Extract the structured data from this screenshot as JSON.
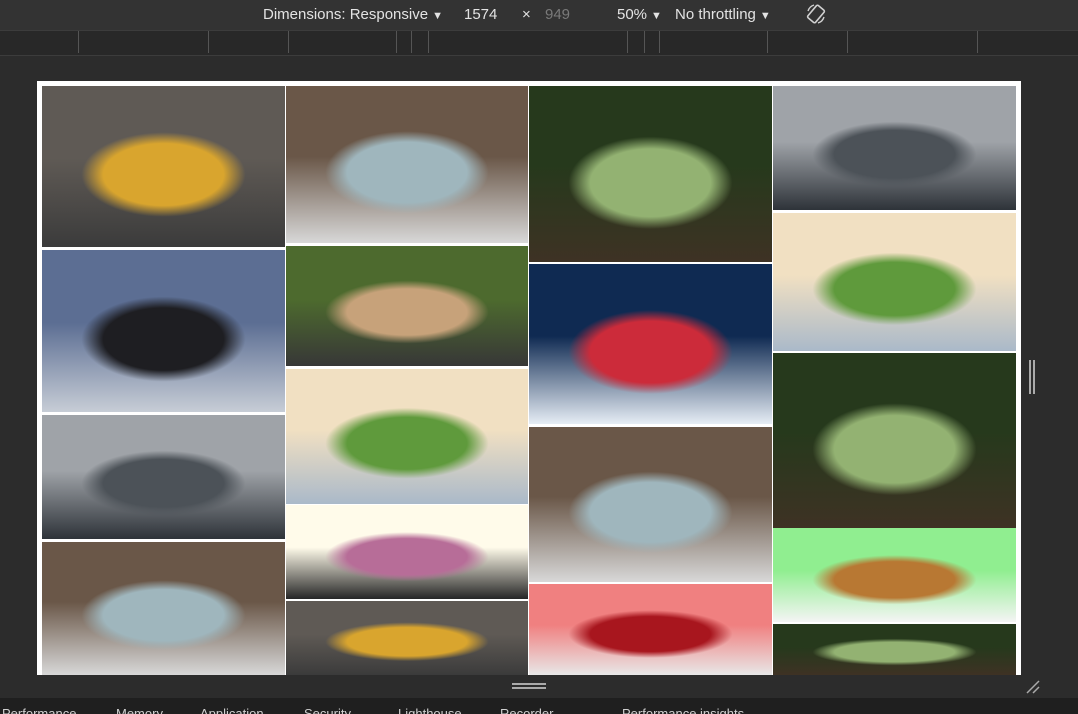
{
  "toolbar": {
    "dimensions_label": "Dimensions: Responsive",
    "width": "1574",
    "times": "×",
    "height": "949",
    "zoom": "50%",
    "throttling": "No throttling"
  },
  "viewport": {
    "tiles": [
      {
        "name": "yellow-sedan-photo",
        "colors": [
          "#5f5a55",
          "#d9a52e",
          "#3b3b3b"
        ]
      },
      {
        "name": "silver-convertible-photo",
        "colors": [
          "#6a5748",
          "#9fb6bd",
          "#d8d8d8"
        ]
      },
      {
        "name": "green-microcar-photo",
        "colors": [
          "#26391c",
          "#93b272",
          "#3e3224"
        ]
      },
      {
        "name": "grey-coupe-garage-photo",
        "colors": [
          "#9fa3a8",
          "#4c5258",
          "#2e3339"
        ]
      },
      {
        "name": "black-mustang-photo",
        "colors": [
          "#5c6e93",
          "#1e1e22",
          "#c7cdd6"
        ]
      },
      {
        "name": "convertible-interior-photo",
        "colors": [
          "#4d6a2e",
          "#c7a27a",
          "#373737"
        ]
      },
      {
        "name": "red-beetle-snow-photo",
        "colors": [
          "#0f2a52",
          "#cc2b3a",
          "#e6edf5"
        ]
      },
      {
        "name": "palm-beach-aerial-photo",
        "colors": [
          "#f1e0c2",
          "#5f9a3c",
          "#aab9c9"
        ]
      },
      {
        "name": "palm-beach-aerial-photo-2",
        "colors": [
          "#f1e0c2",
          "#5f9a3c",
          "#aab9c9"
        ]
      },
      {
        "name": "grey-coupe-garage-photo-2",
        "colors": [
          "#9fa3a8",
          "#4c5258",
          "#2e3339"
        ]
      },
      {
        "name": "silver-convertible-photo-2",
        "colors": [
          "#6a5748",
          "#9fb6bd",
          "#d8d8d8"
        ]
      },
      {
        "name": "green-microcar-photo-2",
        "colors": [
          "#26391c",
          "#93b272",
          "#3e3224"
        ]
      },
      {
        "name": "pink-sedan-photo",
        "colors": [
          "#fffbea",
          "#b76d98",
          "#262626"
        ]
      },
      {
        "name": "silver-convertible-photo-3",
        "colors": [
          "#6a5748",
          "#9fb6bd",
          "#d8d8d8"
        ]
      },
      {
        "name": "brown-convertible-photo",
        "colors": [
          "#90ee90",
          "#b87833",
          "#f5f5f5"
        ]
      },
      {
        "name": "yellow-sedan-photo-2",
        "colors": [
          "#5f5a55",
          "#d9a52e",
          "#3b3b3b"
        ]
      },
      {
        "name": "red-convertible-photo",
        "colors": [
          "#f08080",
          "#a8161e",
          "#e8e8e8"
        ]
      },
      {
        "name": "green-microcar-photo-3",
        "colors": [
          "#26391c",
          "#93b272",
          "#3e3224"
        ]
      }
    ]
  },
  "bottom_tabs": [
    {
      "label": "Performance"
    },
    {
      "label": "Memory"
    },
    {
      "label": "Application"
    },
    {
      "label": "Security"
    },
    {
      "label": "Lighthouse"
    },
    {
      "label": "Recorder"
    },
    {
      "label": "Performance insights"
    }
  ]
}
